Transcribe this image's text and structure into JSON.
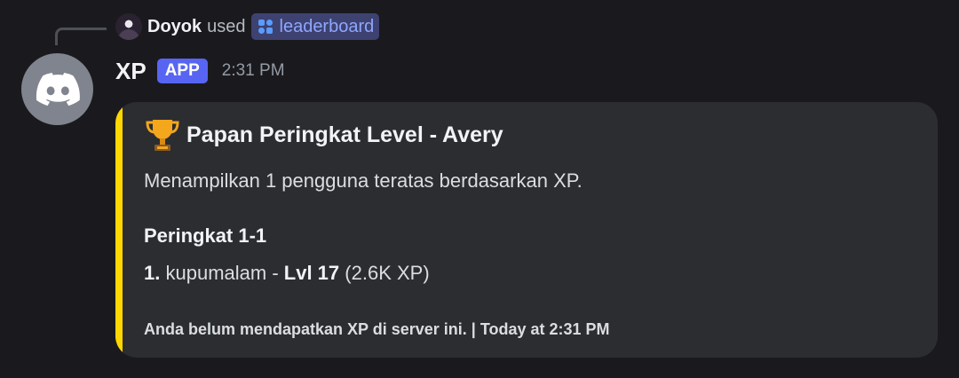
{
  "usage": {
    "user": "Doyok",
    "verb": "used",
    "command": "leaderboard"
  },
  "message": {
    "bot_name": "XP",
    "badge": "APP",
    "timestamp": "2:31 PM"
  },
  "embed": {
    "accent_color": "#ffd700",
    "title_emoji": "trophy-icon",
    "title": "Papan Peringkat Level - Avery",
    "description": "Menampilkan 1 pengguna teratas berdasarkan XP.",
    "field": {
      "name": "Peringkat 1-1",
      "entry": {
        "rank": "1.",
        "username": "kupumalam",
        "separator": "-",
        "level": "Lvl 17",
        "xp": "(2.6K XP)"
      }
    },
    "footer": "Anda belum mendapatkan XP di server ini. | Today at 2:31 PM"
  }
}
